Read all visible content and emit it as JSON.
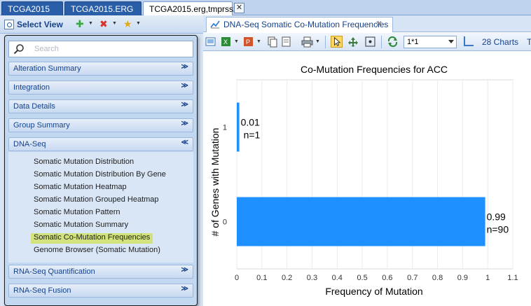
{
  "doc_tabs": [
    "TCGA2015",
    "TCGA2015.ERG",
    "TCGA2015.erg,tmprss2"
  ],
  "active_doc_tab": 2,
  "toolbar_left": {
    "select_view_label": "Select View"
  },
  "nav": {
    "search_placeholder": "Search",
    "groups": [
      {
        "label": "Alteration Summary",
        "expanded": false
      },
      {
        "label": "Integration",
        "expanded": false
      },
      {
        "label": "Data Details",
        "expanded": false
      },
      {
        "label": "Group Summary",
        "expanded": false
      },
      {
        "label": "DNA-Seq",
        "expanded": true
      },
      {
        "label": "RNA-Seq Quantification",
        "expanded": false
      },
      {
        "label": "RNA-Seq Fusion",
        "expanded": false
      }
    ],
    "dna_seq_items": [
      "Somatic Mutation Distribution",
      "Somatic Mutation Distribution By Gene",
      "Somatic Mutation Heatmap",
      "Somatic Mutation Grouped Heatmap",
      "Somatic Mutation Pattern",
      "Somatic Mutation Summary",
      "Somatic Co-Mutation Frequencies",
      "Genome Browser (Somatic Mutation)"
    ],
    "selected_item": "Somatic Co-Mutation Frequencies",
    "chevron_collapsed": "≫",
    "chevron_expanded": "≪"
  },
  "chart_window": {
    "tab_label": "DNA-Seq Somatic Co-Mutation Frequencies",
    "layout_select": "1*1",
    "charts_count_label": "28 Charts",
    "more_label": "T"
  },
  "colors": {
    "bar": "#1e90ff",
    "selected_highlight": "#d2e27d",
    "accent": "#15428b"
  },
  "chart_data": {
    "type": "bar",
    "orientation": "horizontal",
    "title": "Co-Mutation Frequencies for ACC",
    "xlabel": "Frequency of Mutation",
    "ylabel": "# of Genes with Mutation",
    "xlim": [
      0,
      1.1
    ],
    "xticks": [
      "0",
      "0.1",
      "0.2",
      "0.3",
      "0.4",
      "0.5",
      "0.6",
      "0.7",
      "0.8",
      "0.9",
      "1",
      "1.1"
    ],
    "categories": [
      "1",
      "0"
    ],
    "values": [
      0.01,
      0.99
    ],
    "value_labels": [
      "0.01",
      "0.99"
    ],
    "count_labels": [
      "n=1",
      "n=90"
    ],
    "grid": true
  }
}
